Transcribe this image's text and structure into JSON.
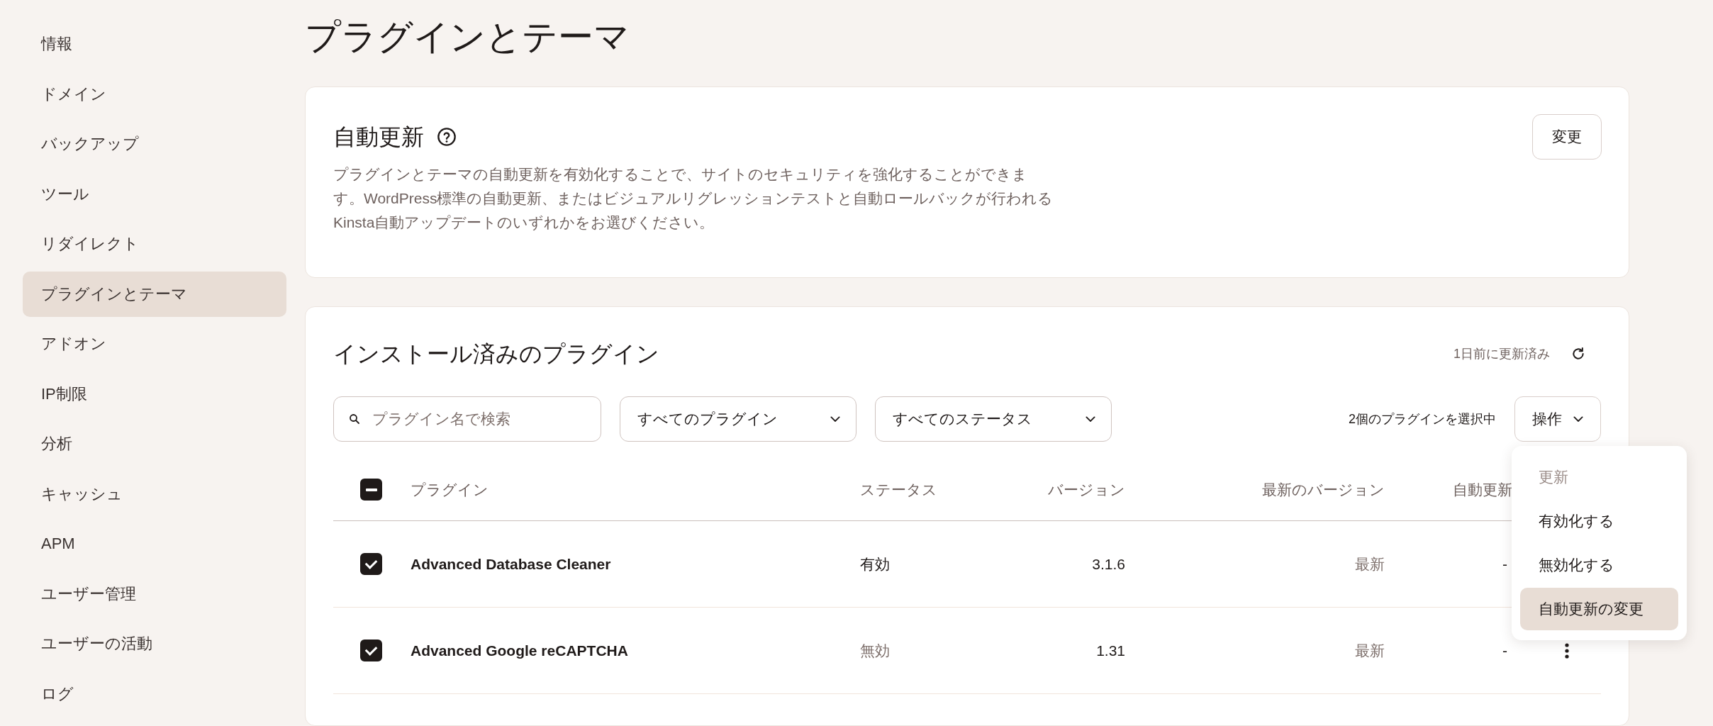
{
  "sidebar": {
    "items": [
      {
        "label": "情報",
        "selected": false
      },
      {
        "label": "ドメイン",
        "selected": false
      },
      {
        "label": "バックアップ",
        "selected": false
      },
      {
        "label": "ツール",
        "selected": false
      },
      {
        "label": "リダイレクト",
        "selected": false
      },
      {
        "label": "プラグインとテーマ",
        "selected": true
      },
      {
        "label": "アドオン",
        "selected": false
      },
      {
        "label": "IP制限",
        "selected": false
      },
      {
        "label": "分析",
        "selected": false
      },
      {
        "label": "キャッシュ",
        "selected": false
      },
      {
        "label": "APM",
        "selected": false
      },
      {
        "label": "ユーザー管理",
        "selected": false
      },
      {
        "label": "ユーザーの活動",
        "selected": false
      },
      {
        "label": "ログ",
        "selected": false
      }
    ]
  },
  "page_title": "プラグインとテーマ",
  "auto_update_card": {
    "title": "自動更新",
    "description": "プラグインとテーマの自動更新を有効化することで、サイトのセキュリティを強化することができます。WordPress標準の自動更新、またはビジュアルリグレッションテストと自動ロールバックが行われるKinsta自動アップデートのいずれかをお選びください。",
    "button": "変更"
  },
  "plugins_card": {
    "title": "インストール済みのプラグイン",
    "updated": "1日前に更新済み",
    "search": {
      "placeholder": "プラグイン名で検索"
    },
    "filters": [
      "すべてのプラグイン",
      "すべてのステータス"
    ],
    "selection": "2個のプラグインを選択中",
    "actions_button": "操作",
    "actions_menu": [
      {
        "label": "更新",
        "disabled": true,
        "selected": false
      },
      {
        "label": "有効化する",
        "disabled": false,
        "selected": false
      },
      {
        "label": "無効化する",
        "disabled": false,
        "selected": false
      },
      {
        "label": "自動更新の変更",
        "disabled": false,
        "selected": true
      }
    ],
    "table": {
      "header_checkbox": {
        "indeterminate": true
      },
      "columns": [
        "プラグイン",
        "ステータス",
        "バージョン",
        "最新のバージョン",
        "自動更新"
      ],
      "rows": [
        {
          "checked": true,
          "name": "Advanced Database Cleaner",
          "status": "有効",
          "active": true,
          "version": "3.1.6",
          "latest": "最新",
          "auto_update": "-"
        },
        {
          "checked": true,
          "name": "Advanced Google reCAPTCHA",
          "status": "無効",
          "active": false,
          "version": "1.31",
          "latest": "最新",
          "auto_update": "-"
        }
      ]
    }
  }
}
